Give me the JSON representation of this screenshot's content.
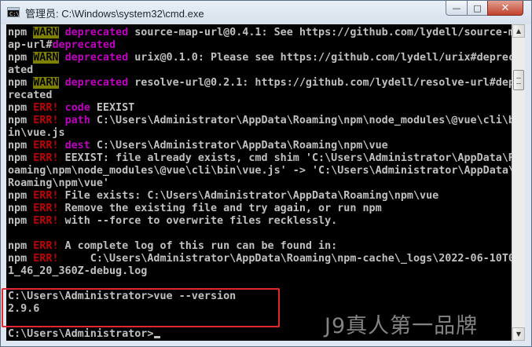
{
  "window": {
    "title": "管理员: C:\\Windows\\system32\\cmd.exe",
    "controls": {
      "minimize": "—",
      "maximize": "□",
      "close": "✕"
    }
  },
  "console": {
    "lines": [
      {
        "id": "l0",
        "segments": [
          {
            "t": "npm "
          },
          {
            "t": "WARN",
            "c": "warn"
          },
          {
            "t": " "
          },
          {
            "t": "deprecated",
            "c": "mag"
          },
          {
            "t": " source-map-url@0.4.1: See https://github.com/lydell/source-m"
          }
        ]
      },
      {
        "id": "l1",
        "segments": [
          {
            "t": "ap-url#"
          },
          {
            "t": "deprecated",
            "c": "mag"
          }
        ]
      },
      {
        "id": "l2",
        "segments": [
          {
            "t": "npm "
          },
          {
            "t": "WARN",
            "c": "warn"
          },
          {
            "t": " "
          },
          {
            "t": "deprecated",
            "c": "mag"
          },
          {
            "t": " urix@0.1.0: Please see https://github.com/lydell/urix#deprec"
          }
        ]
      },
      {
        "id": "l3",
        "segments": [
          {
            "t": "ated"
          }
        ]
      },
      {
        "id": "l4",
        "segments": [
          {
            "t": "npm "
          },
          {
            "t": "WARN",
            "c": "warn"
          },
          {
            "t": " "
          },
          {
            "t": "deprecated",
            "c": "mag"
          },
          {
            "t": " resolve-url@0.2.1: https://github.com/lydell/resolve-url#dep"
          }
        ]
      },
      {
        "id": "l5",
        "segments": [
          {
            "t": "recated"
          }
        ]
      },
      {
        "id": "l6",
        "segments": [
          {
            "t": "npm "
          },
          {
            "t": "ERR!",
            "c": "err"
          },
          {
            "t": " "
          },
          {
            "t": "code",
            "c": "mag"
          },
          {
            "t": " EEXIST"
          }
        ]
      },
      {
        "id": "l7",
        "segments": [
          {
            "t": "npm "
          },
          {
            "t": "ERR!",
            "c": "err"
          },
          {
            "t": " "
          },
          {
            "t": "path",
            "c": "mag"
          },
          {
            "t": " C:\\Users\\Administrator\\AppData\\Roaming\\npm\\node_modules\\@vue\\cli\\b"
          }
        ]
      },
      {
        "id": "l8",
        "segments": [
          {
            "t": "in\\vue.js"
          }
        ]
      },
      {
        "id": "l9",
        "segments": [
          {
            "t": "npm "
          },
          {
            "t": "ERR!",
            "c": "err"
          },
          {
            "t": " "
          },
          {
            "t": "dest",
            "c": "mag"
          },
          {
            "t": " C:\\Users\\Administrator\\AppData\\Roaming\\npm\\vue"
          }
        ]
      },
      {
        "id": "l10",
        "segments": [
          {
            "t": "npm "
          },
          {
            "t": "ERR!",
            "c": "err"
          },
          {
            "t": " EEXIST: file already exists, cmd shim 'C:\\Users\\Administrator\\AppData\\R"
          }
        ]
      },
      {
        "id": "l11",
        "segments": [
          {
            "t": "oaming\\npm\\node_modules\\@vue\\cli\\bin\\vue.js' -> 'C:\\Users\\Administrator\\AppData\\"
          }
        ]
      },
      {
        "id": "l12",
        "segments": [
          {
            "t": "Roaming\\npm\\vue'"
          }
        ]
      },
      {
        "id": "l13",
        "segments": [
          {
            "t": "npm "
          },
          {
            "t": "ERR!",
            "c": "err"
          },
          {
            "t": " File exists: C:\\Users\\Administrator\\AppData\\Roaming\\npm\\vue"
          }
        ]
      },
      {
        "id": "l14",
        "segments": [
          {
            "t": "npm "
          },
          {
            "t": "ERR!",
            "c": "err"
          },
          {
            "t": " Remove the existing file and try again, or run npm"
          }
        ]
      },
      {
        "id": "l15",
        "segments": [
          {
            "t": "npm "
          },
          {
            "t": "ERR!",
            "c": "err"
          },
          {
            "t": " with --force to overwrite files recklessly."
          }
        ]
      },
      {
        "id": "l16",
        "segments": [
          {
            "t": ""
          }
        ]
      },
      {
        "id": "l17",
        "segments": [
          {
            "t": "npm "
          },
          {
            "t": "ERR!",
            "c": "err"
          },
          {
            "t": " A complete log of this run can be found in:"
          }
        ]
      },
      {
        "id": "l18",
        "segments": [
          {
            "t": "npm "
          },
          {
            "t": "ERR!",
            "c": "err"
          },
          {
            "t": "     C:\\Users\\Administrator\\AppData\\Roaming\\npm-cache\\_logs\\2022-06-10T0"
          }
        ]
      },
      {
        "id": "l19",
        "segments": [
          {
            "t": "1_46_20_360Z-debug.log"
          }
        ]
      },
      {
        "id": "l20",
        "segments": [
          {
            "t": ""
          }
        ]
      },
      {
        "id": "l21",
        "segments": [
          {
            "t": "C:\\Users\\Administrator>vue --version"
          }
        ]
      },
      {
        "id": "l22",
        "segments": [
          {
            "t": "2.9.6"
          }
        ]
      },
      {
        "id": "l23",
        "segments": [
          {
            "t": ""
          }
        ]
      },
      {
        "id": "l24",
        "segments": [
          {
            "t": "C:\\Users\\Administrator>"
          }
        ]
      }
    ]
  },
  "watermark": "J9真人第一品牌",
  "scrollbar": {
    "up": "▲",
    "down": "▼"
  }
}
